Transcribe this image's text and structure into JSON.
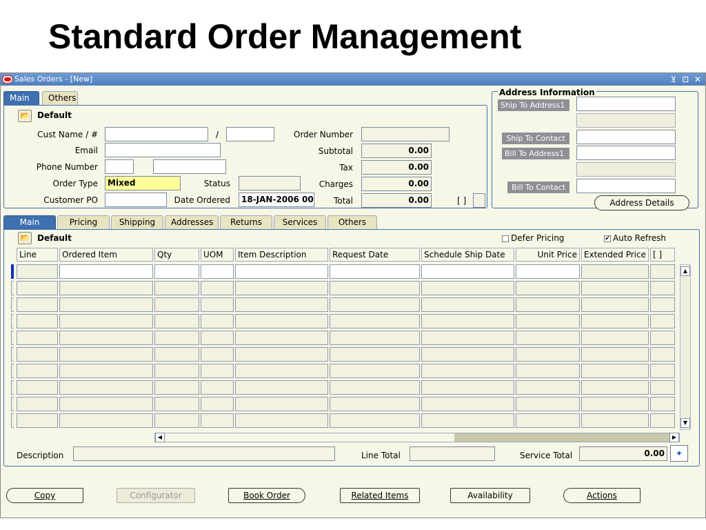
{
  "slide": {
    "title": "Standard Order Management"
  },
  "window": {
    "title": "Sales Orders - [New]",
    "controls": "⊻ ⊡ ✕"
  },
  "header_tabs": [
    {
      "label": "Main"
    },
    {
      "label": "Others"
    }
  ],
  "header": {
    "folder_label": "Default",
    "cust_name_label": "Cust Name / #",
    "slash": "/",
    "email_label": "Email",
    "phone_label": "Phone Number",
    "order_type_label": "Order Type",
    "order_type_value": "Mixed",
    "customer_po_label": "Customer PO",
    "status_label": "Status",
    "date_ordered_label": "Date Ordered",
    "date_ordered_value": "18-JAN-2006 00:",
    "order_number_label": "Order Number",
    "subtotal_label": "Subtotal",
    "subtotal_value": "0.00",
    "tax_label": "Tax",
    "tax_value": "0.00",
    "charges_label": "Charges",
    "charges_value": "0.00",
    "total_label": "Total",
    "total_value": "0.00",
    "bracket": "[ ]"
  },
  "address": {
    "section_title": "Address Information",
    "ship_to_address": "Ship To Address1",
    "ship_to_contact": "Ship To Contact",
    "bill_to_address": "Bill To Address1",
    "bill_to_contact": "Bill To Contact",
    "details_button": "Address Details"
  },
  "line_tabs": [
    {
      "label": "Main"
    },
    {
      "label": "Pricing"
    },
    {
      "label": "Shipping"
    },
    {
      "label": "Addresses"
    },
    {
      "label": "Returns"
    },
    {
      "label": "Services"
    },
    {
      "label": "Others"
    }
  ],
  "lines": {
    "folder_label": "Default",
    "defer_pricing": "Defer Pricing",
    "auto_refresh": "Auto Refresh",
    "auto_refresh_check": "✔",
    "columns": [
      {
        "label": "Line"
      },
      {
        "label": "Ordered Item"
      },
      {
        "label": "Qty"
      },
      {
        "label": "UOM"
      },
      {
        "label": "Item Description"
      },
      {
        "label": "Request Date"
      },
      {
        "label": "Schedule Ship Date"
      },
      {
        "label": "Unit Price"
      },
      {
        "label": "Extended Price"
      },
      {
        "label": "[ ]"
      }
    ],
    "row_count": 10,
    "description_label": "Description",
    "line_total_label": "Line Total",
    "service_total_label": "Service Total",
    "service_total_value": "0.00"
  },
  "buttons": {
    "copy": "Copy",
    "configurator": "Configurator",
    "book_order": "Book Order",
    "related_items": "Related Items",
    "availability": "Availability",
    "actions": "Actions"
  }
}
